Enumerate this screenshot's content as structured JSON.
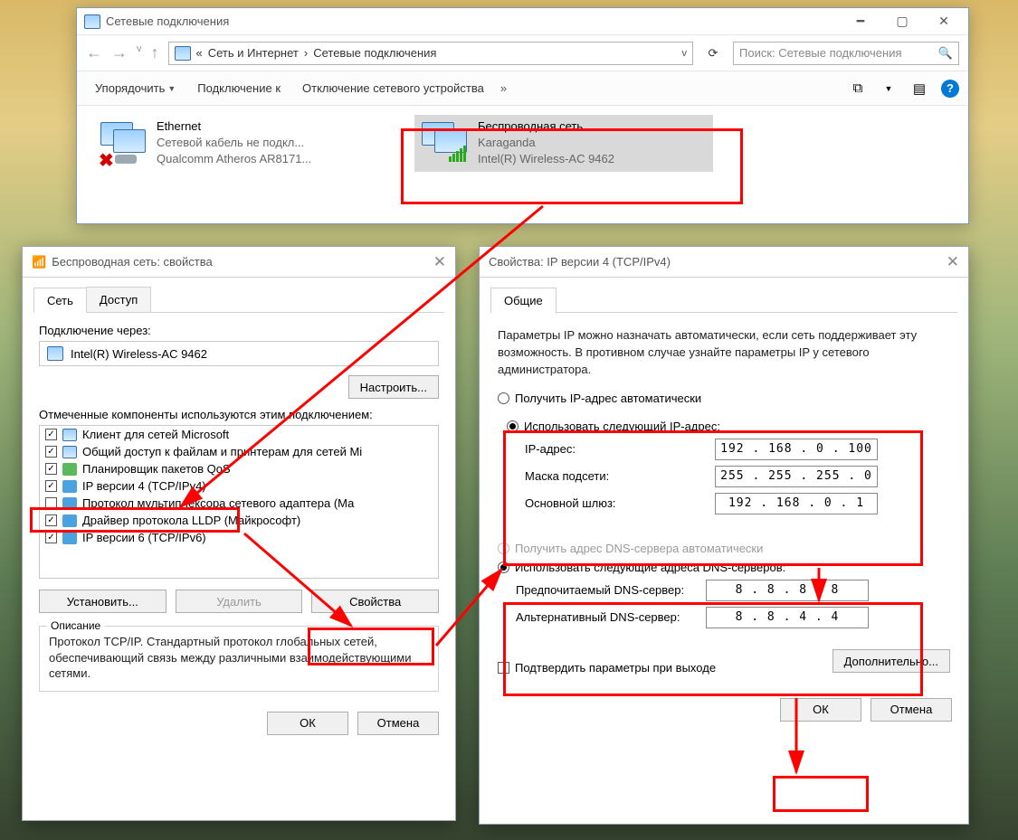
{
  "explorer": {
    "title": "Сетевые подключения",
    "breadcrumb": {
      "p1": "Сеть и Интернет",
      "p2": "Сетевые подключения"
    },
    "search_placeholder": "Поиск: Сетевые подключения",
    "toolbar": {
      "organize": "Упорядочить",
      "connect": "Подключение к",
      "disable": "Отключение сетевого устройства",
      "chev": "»"
    },
    "items": [
      {
        "name": "Ethernet",
        "status": "Сетевой кабель не подкл...",
        "device": "Qualcomm Atheros AR8171..."
      },
      {
        "name": "Беспроводная сеть",
        "status": "Karaganda",
        "device": "Intel(R) Wireless-AC 9462"
      }
    ]
  },
  "props1": {
    "title": "Беспроводная сеть: свойства",
    "tabs": {
      "t1": "Сеть",
      "t2": "Доступ"
    },
    "conn_label": "Подключение через:",
    "adapter": "Intel(R) Wireless-AC 9462",
    "configure": "Настроить...",
    "list_label": "Отмеченные компоненты используются этим подключением:",
    "components": [
      {
        "checked": true,
        "label": "Клиент для сетей Microsoft"
      },
      {
        "checked": true,
        "label": "Общий доступ к файлам и принтерам для сетей Mi"
      },
      {
        "checked": true,
        "label": "Планировщик пакетов QoS"
      },
      {
        "checked": true,
        "label": "IP версии 4 (TCP/IPv4)"
      },
      {
        "checked": false,
        "label": "Протокол мультиплексора сетевого адаптера (Ма"
      },
      {
        "checked": true,
        "label": "Драйвер протокола LLDP (Майкрософт)"
      },
      {
        "checked": true,
        "label": "IP версии 6 (TCP/IPv6)"
      }
    ],
    "install": "Установить...",
    "remove": "Удалить",
    "properties": "Свойства",
    "desc_label": "Описание",
    "desc": "Протокол TCP/IP. Стандартный протокол глобальных сетей, обеспечивающий связь между различными взаимодействующими сетями.",
    "ok": "ОК",
    "cancel": "Отмена"
  },
  "ipv4": {
    "title": "Свойства: IP версии 4 (TCP/IPv4)",
    "tab": "Общие",
    "intro": "Параметры IP можно назначать автоматически, если сеть поддерживает эту возможность. В противном случае узнайте параметры IP у сетевого администратора.",
    "r_auto_ip": "Получить IP-адрес автоматически",
    "r_static_ip": "Использовать следующий IP-адрес:",
    "ip_label": "IP-адрес:",
    "ip_val": "192 . 168 .  0  . 100",
    "mask_label": "Маска подсети:",
    "mask_val": "255 . 255 . 255 .  0",
    "gw_label": "Основной шлюз:",
    "gw_val": "192 . 168 .  0  .  1",
    "r_auto_dns": "Получить адрес DNS-сервера автоматически",
    "r_static_dns": "Использовать следующие адреса DNS-серверов:",
    "dns1_label": "Предпочитаемый DNS-сервер:",
    "dns1_val": "8  .  8  .  8  .  8",
    "dns2_label": "Альтернативный DNS-сервер:",
    "dns2_val": "8  .  8  .  4  .  4",
    "confirm": "Подтвердить параметры при выходе",
    "advanced": "Дополнительно...",
    "ok": "ОК",
    "cancel": "Отмена"
  }
}
